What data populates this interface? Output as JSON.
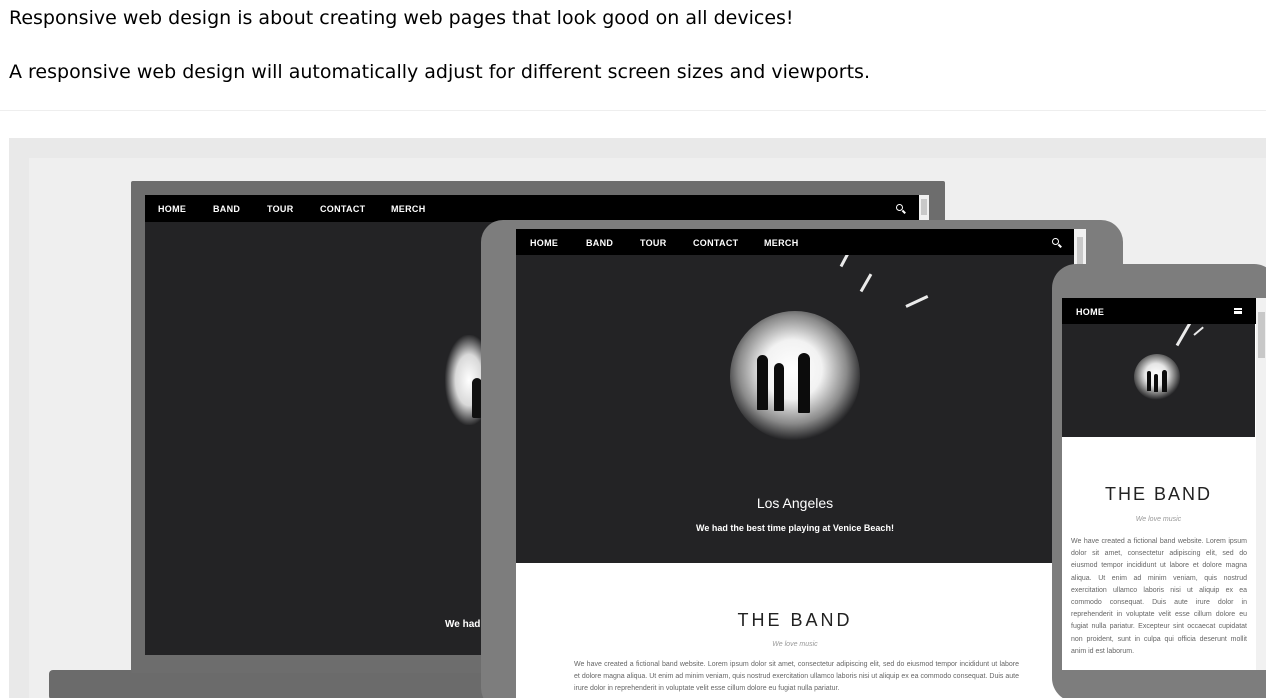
{
  "intro": {
    "p1": "Responsive web design is about creating web pages that look good on all devices!",
    "p2": "A responsive web design will automatically adjust for different screen sizes and viewports."
  },
  "figure": {
    "desktop": {
      "nav": [
        "HOME",
        "BAND",
        "TOUR",
        "CONTACT",
        "MERCH"
      ],
      "caption_fragment": "We had th"
    },
    "tablet": {
      "nav": [
        "HOME",
        "BAND",
        "TOUR",
        "CONTACT",
        "MERCH"
      ],
      "city": "Los Angeles",
      "subtitle": "We had the best time playing at Venice Beach!",
      "band_title": "THE BAND",
      "tagline": "We love music",
      "body": "We have created a fictional band website. Lorem ipsum dolor sit amet, consectetur adipiscing elit, sed do eiusmod tempor incididunt ut labore et dolore magna aliqua. Ut enim ad minim veniam, quis nostrud exercitation ullamco laboris nisi ut aliquip ex ea commodo consequat. Duis aute irure dolor in reprehenderit in voluptate velit esse cillum dolore eu fugiat nulla pariatur."
    },
    "phone": {
      "nav": "HOME",
      "band_title": "THE BAND",
      "tagline": "We love music",
      "body": "We have created a fictional band website. Lorem ipsum dolor sit amet, consectetur adipiscing elit, sed do eiusmod tempor incididunt ut labore et dolore magna aliqua. Ut enim ad minim veniam, quis nostrud exercitation ullamco laboris nisi ut aliquip ex ea commodo consequat. Duis aute irure dolor in reprehenderit in voluptate velit esse cillum dolore eu fugiat nulla pariatur. Excepteur sint occaecat cupidatat non proident, sunt in culpa qui officia deserunt mollit anim id est laborum."
    },
    "icons": {
      "search": "search-icon",
      "menu": "hamburger-menu-icon"
    },
    "colors": {
      "screen_dark": "#232325",
      "nav_black": "#000000",
      "device_gray": "#7d7d7d"
    }
  }
}
